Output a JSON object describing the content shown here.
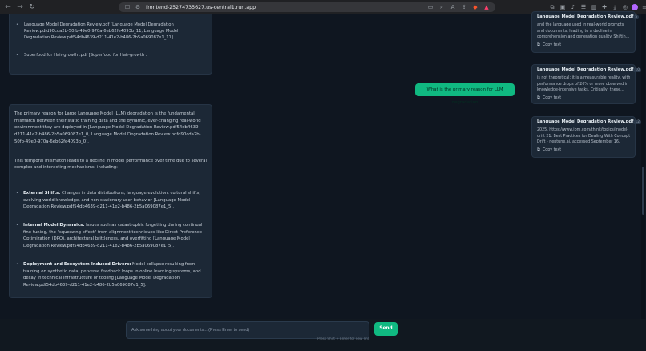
{
  "browser": {
    "url": "frontend-25274735627.us-central1.run.app",
    "icons": {
      "back": "←",
      "forward": "→",
      "reload": "↻",
      "bookmark": "☐",
      "site_info": "⚙"
    }
  },
  "chat": {
    "top_sources": [
      "Language Model Degradation Review.pdf [Language Model Degradation Review.pdfd90cda2b-50fb-49e0-970a-6eb62fe4093b_11, Language Model Degradation Review.pdf54db4639-d211-41e2-b486-2b5a069087e1_11]",
      "Superfood for Hair-growth .pdf [Superfood for Hair-growth ."
    ],
    "user_message": "What is the primary reason for LLM degradation",
    "answer": {
      "para1": "The primary reason for Large Language Model (LLM) degradation is the fundamental mismatch between their static training data and the dynamic, ever-changing real-world environment they are deployed in [Language Model Degradation Review.pdf54db4639-d211-41e2-b486-2b5a069087e1_0, Language Model Degradation Review.pdfd90cda2b-50fb-49e0-970a-6eb62fe4093b_0].",
      "para2": "This temporal mismatch leads to a decline in model performance over time due to several complex and interacting mechanisms, including:",
      "bullets": [
        {
          "title": "External Shifts:",
          "text": " Changes in data distributions, language evolution, cultural shifts, evolving world knowledge, and non-stationary user behavior [Language Model Degradation Review.pdf54db4639-d211-41e2-b486-2b5a069087e1_5]."
        },
        {
          "title": "Internal Model Dynamics:",
          "text": " Issues such as catastrophic forgetting during continual fine-tuning, the \"squeezing effect\" from alignment techniques like Direct Preference Optimization (DPO), architectural brittleness, and overfitting [Language Model Degradation Review.pdf54db4639-d211-41e2-b486-2b5a069087e1_5]."
        },
        {
          "title": "Deployment and Ecosystem-Induced Drivers:",
          "text": " Model collapse resulting from training on synthetic data, perverse feedback loops in online learning systems, and decay in technical infrastructure or tooling [Language Model Degradation Review.pdf54db4639-d211-41e2-b486-2b5a069087e1_5]."
        }
      ]
    }
  },
  "sources_panel": {
    "cards": [
      {
        "title": "Language Model Degradation Review.pdf",
        "score": "5",
        "snippet": "and the language used in real-world prompts and documents, leading to a decline in comprehension and generation quality. Shiftin...",
        "copy_label": "Copy text"
      },
      {
        "title": "Language Model Degradation Review.pdf",
        "score": "10",
        "snippet": "is not theoretical; it is a measurable reality, with performance drops of 20% or more observed in knowledge-intensive tasks. Critically, these...",
        "copy_label": "Copy text"
      },
      {
        "title": "Language Model Degradation Review.pdf",
        "score": "12",
        "snippet": "2025, https://www.ibm.com/think/topics/model-drift 21. Best Practices for Dealing With Concept Drift - neptune.ai, accessed September 16, 202...",
        "copy_label": "Copy text"
      }
    ]
  },
  "composer": {
    "placeholder": "Ask something about your documents... (Press Enter to send)",
    "send_label": "Send",
    "hint": "Press Shift + Enter for new line"
  },
  "colors": {
    "accent": "#10b981",
    "background": "#0f1620",
    "card": "#1c2836"
  }
}
